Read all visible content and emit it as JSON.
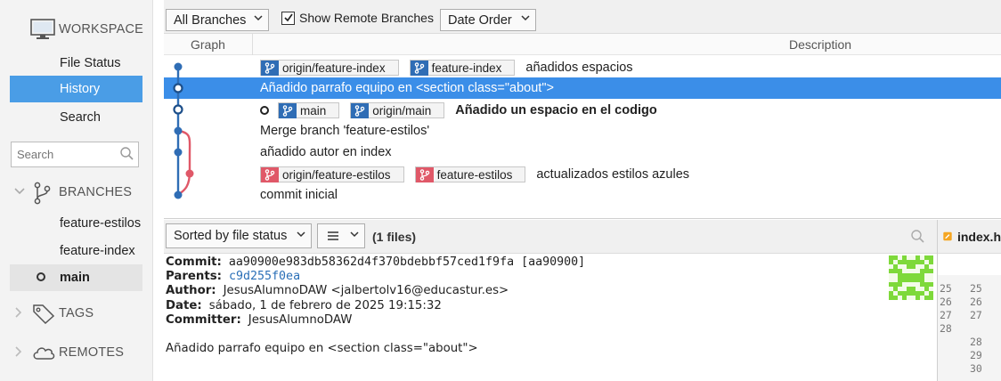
{
  "sidebar": {
    "workspace": {
      "title": "WORKSPACE",
      "items": [
        "File Status",
        "History",
        "Search"
      ],
      "active": "History"
    },
    "search_placeholder": "Search",
    "branches": {
      "title": "BRANCHES",
      "items": [
        "feature-estilos",
        "feature-index",
        "main"
      ],
      "current": "main"
    },
    "tags": {
      "title": "TAGS"
    },
    "remotes": {
      "title": "REMOTES"
    }
  },
  "toolbar": {
    "branches_dropdown": "All Branches",
    "show_remote_label": "Show Remote Branches",
    "show_remote_checked": true,
    "order_dropdown": "Date Order"
  },
  "history": {
    "columns": {
      "graph": "Graph",
      "description": "Description"
    },
    "commits": [
      {
        "refs": [
          {
            "name": "origin/feature-index",
            "color": "blue"
          },
          {
            "name": "feature-index",
            "color": "blue"
          }
        ],
        "message": "añadidos espacios",
        "head": false,
        "selected": false,
        "bold": false
      },
      {
        "refs": [],
        "message": "Añadido parrafo equipo en <section class=\"about\">",
        "head": false,
        "selected": true,
        "bold": false
      },
      {
        "refs": [
          {
            "name": "main",
            "color": "blue"
          },
          {
            "name": "origin/main",
            "color": "blue"
          }
        ],
        "message": "Añadido un espacio en el codigo",
        "head": true,
        "selected": false,
        "bold": true
      },
      {
        "refs": [],
        "message": "Merge branch 'feature-estilos'",
        "head": false,
        "selected": false,
        "bold": false
      },
      {
        "refs": [],
        "message": "añadido autor en index",
        "head": false,
        "selected": false,
        "bold": false
      },
      {
        "refs": [
          {
            "name": "origin/feature-estilos",
            "color": "red"
          },
          {
            "name": "feature-estilos",
            "color": "red"
          }
        ],
        "message": "actualizados estilos azules",
        "head": false,
        "selected": false,
        "bold": false
      },
      {
        "refs": [],
        "message": "commit inicial",
        "head": false,
        "selected": false,
        "bold": false
      }
    ]
  },
  "files_bar": {
    "sort_dropdown": "Sorted by file status",
    "count": "(1 files)"
  },
  "details": {
    "commit_label": "Commit:",
    "commit_value": "aa90900e983db58362d4f370bdebbf57ced1f9fa [aa90900]",
    "parents_label": "Parents:",
    "parents_value": "c9d255f0ea",
    "author_label": "Author:",
    "author_value": "JesusAlumnoDAW <jalbertolv16@educastur.es>",
    "date_label": "Date:",
    "date_value": "sábado, 1 de febrero de 2025 19:15:32",
    "committer_label": "Committer:",
    "committer_value": "JesusAlumnoDAW",
    "message": "Añadido parrafo equipo en <section class=\"about\">"
  },
  "diff": {
    "filename": "index.h",
    "gutter": [
      [
        "25",
        "25"
      ],
      [
        "26",
        "26"
      ],
      [
        "27",
        "27"
      ],
      [
        "28",
        ""
      ],
      [
        "",
        "28"
      ],
      [
        "",
        "29"
      ],
      [
        "",
        "30"
      ]
    ]
  },
  "colors": {
    "accent": "#3b8ee8",
    "blue_branch": "#2f6db5",
    "red_branch": "#e05868",
    "avatar": "#7ed93a"
  }
}
